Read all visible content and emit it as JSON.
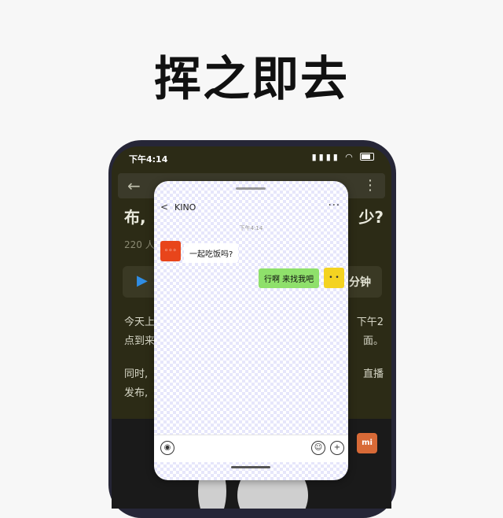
{
  "headline": "挥之即去",
  "status": {
    "time": "下午4:14",
    "signal": "▮▮▮▮",
    "wifi": "◠"
  },
  "appbar": {
    "back": "←",
    "title": "",
    "more": "⋮"
  },
  "article": {
    "title_left": "布,",
    "title_right": "少?",
    "meta": "220 人",
    "audio_play": "▶",
    "audio_duration": "分钟",
    "para1_left": "今天上",
    "para1_right": "下午2",
    "para1_line2_left": "点到来",
    "para1_line2_right": "面。",
    "para2_left": "同时,",
    "para2_right": "直播",
    "para2_line2_left": "发布,"
  },
  "mi_logo": "mi",
  "chat": {
    "back": "<",
    "contact": "KINO",
    "more": "···",
    "timestamp": "下午4:14",
    "messages": [
      {
        "side": "left",
        "text": "一起吃饭吗?",
        "avatar_color": "#e8451b"
      },
      {
        "side": "right",
        "text": "行啊 来找我吧",
        "avatar_color": "#f4d321"
      }
    ],
    "input_voice": "◉",
    "input_emoji": "☺",
    "input_plus": "+"
  }
}
